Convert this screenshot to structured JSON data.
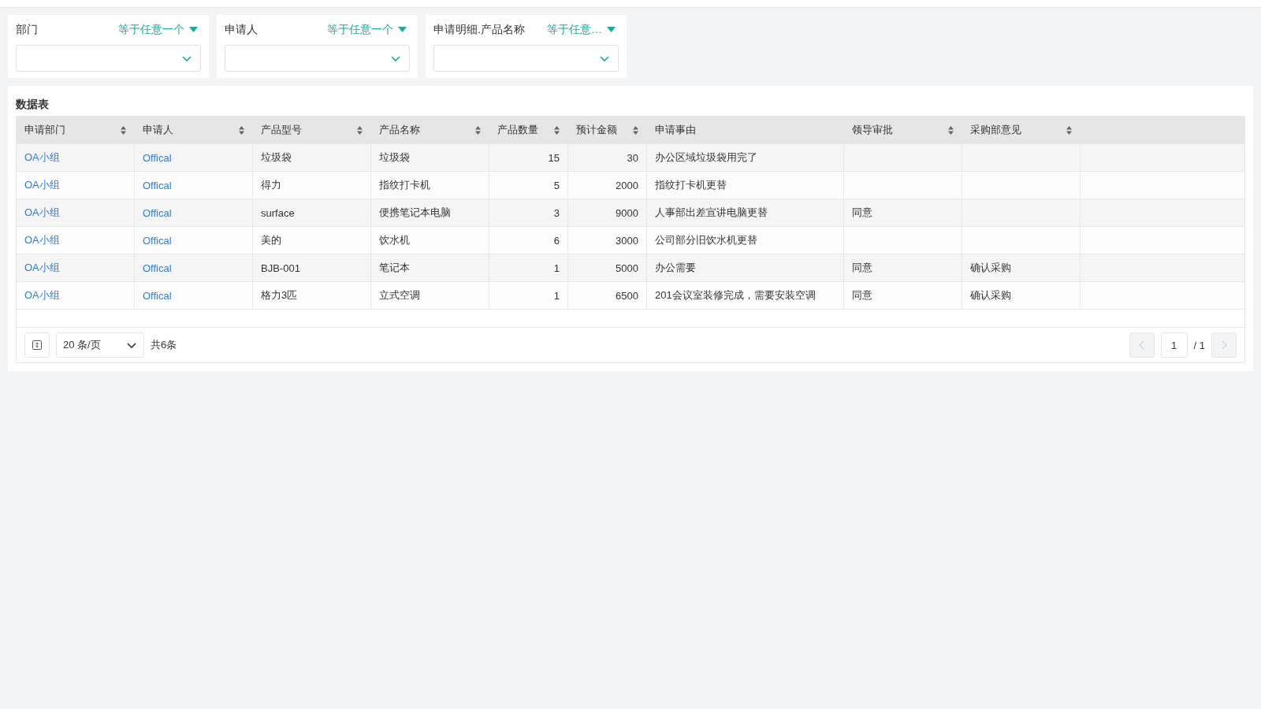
{
  "filters": [
    {
      "label": "部门",
      "operator": "等于任意一个"
    },
    {
      "label": "申请人",
      "operator": "等于任意一个"
    },
    {
      "label": "申请明细.产品名称",
      "operator": "等于任意…"
    }
  ],
  "table": {
    "title": "数据表",
    "columns": [
      {
        "label": "申请部门",
        "kind": "link",
        "sortable": true
      },
      {
        "label": "申请人",
        "kind": "link",
        "sortable": true
      },
      {
        "label": "产品型号",
        "kind": "text",
        "sortable": true
      },
      {
        "label": "产品名称",
        "kind": "text",
        "sortable": true
      },
      {
        "label": "产品数量",
        "kind": "number",
        "sortable": true
      },
      {
        "label": "预计金额",
        "kind": "number",
        "sortable": true
      },
      {
        "label": "申请事由",
        "kind": "wide",
        "sortable": false
      },
      {
        "label": "领导审批",
        "kind": "text",
        "sortable": true
      },
      {
        "label": "采购部意见",
        "kind": "text",
        "sortable": true
      }
    ],
    "rows": [
      [
        "OA小组",
        "Offical",
        "垃圾袋",
        "垃圾袋",
        "15",
        "30",
        "办公区域垃圾袋用完了",
        null,
        null
      ],
      [
        "OA小组",
        "Offical",
        "得力",
        "指纹打卡机",
        "5",
        "2000",
        "指纹打卡机更替",
        null,
        null
      ],
      [
        "OA小组",
        "Offical",
        "surface",
        "便携笔记本电脑",
        "3",
        "9000",
        "人事部出差宣讲电脑更替",
        "同意",
        null
      ],
      [
        "OA小组",
        "Offical",
        "美的",
        "饮水机",
        "6",
        "3000",
        "公司部分旧饮水机更替",
        null,
        null
      ],
      [
        "OA小组",
        "Offical",
        "BJB-001",
        "笔记本",
        "1",
        "5000",
        "办公需要",
        "同意",
        "确认采购"
      ],
      [
        "OA小组",
        "Offical",
        "格力3匹",
        "立式空调",
        "1",
        "6500",
        "201会议室装修完成，需要安装空调",
        "同意",
        "确认采购"
      ]
    ]
  },
  "pagination": {
    "page_size": "20 条/页",
    "total": "共6条",
    "page": "1",
    "page_count": "/ 1",
    "prev_disabled": true,
    "next_disabled": true
  }
}
